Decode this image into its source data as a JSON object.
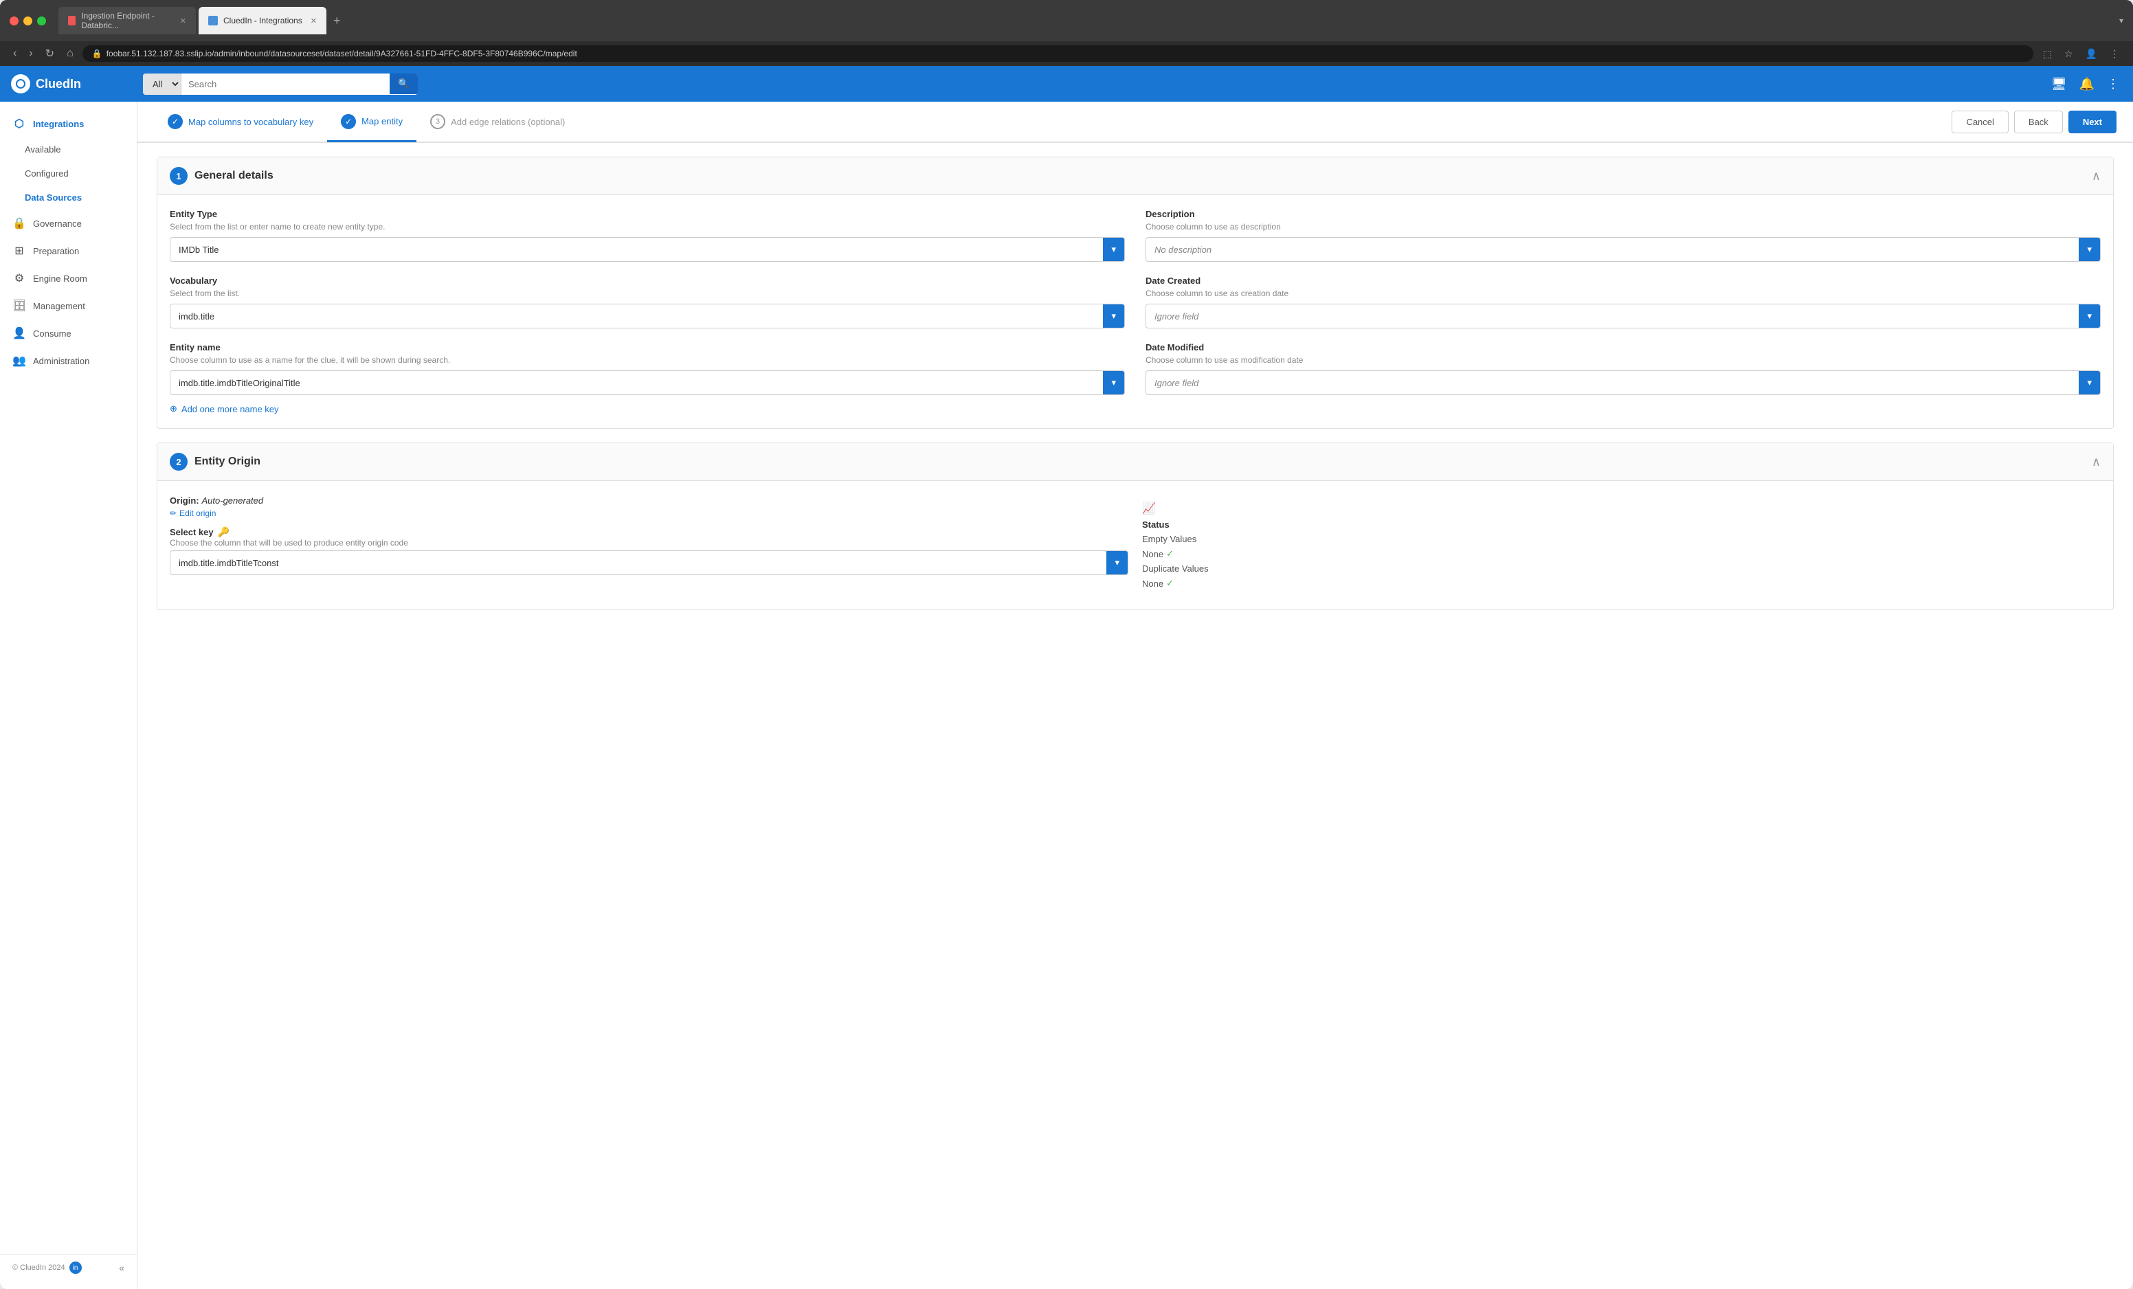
{
  "browser": {
    "url": "foobar.51.132.187.83.sslip.io/admin/inbound/datasourceset/dataset/detail/9A327661-51FD-4FFC-8DF5-3F80746B996C/map/edit",
    "tabs": [
      {
        "id": "tab1",
        "label": "Ingestion Endpoint - Databric...",
        "active": false,
        "favicon_color": "#e55"
      },
      {
        "id": "tab2",
        "label": "CluedIn - Integrations",
        "active": true,
        "favicon_color": "#4a90d9"
      }
    ]
  },
  "topnav": {
    "logo": "CluedIn",
    "search_dropdown": "All",
    "search_placeholder": "Search"
  },
  "sidebar": {
    "items": [
      {
        "id": "integrations",
        "label": "Integrations",
        "icon": "⬡",
        "active": true
      },
      {
        "id": "available",
        "label": "Available",
        "icon": "",
        "active": false,
        "indent": true
      },
      {
        "id": "configured",
        "label": "Configured",
        "icon": "",
        "active": false,
        "indent": true
      },
      {
        "id": "data-sources",
        "label": "Data Sources",
        "icon": "",
        "active": false,
        "indent": true,
        "highlighted": true
      },
      {
        "id": "governance",
        "label": "Governance",
        "icon": "🔒",
        "active": false
      },
      {
        "id": "preparation",
        "label": "Preparation",
        "icon": "⊞",
        "active": false
      },
      {
        "id": "engine-room",
        "label": "Engine Room",
        "icon": "⚙",
        "active": false
      },
      {
        "id": "management",
        "label": "Management",
        "icon": "🗄",
        "active": false
      },
      {
        "id": "consume",
        "label": "Consume",
        "icon": "👤",
        "active": false
      },
      {
        "id": "administration",
        "label": "Administration",
        "icon": "👥",
        "active": false
      }
    ],
    "footer": "© CluedIn 2024",
    "collapse_icon": "«"
  },
  "wizard": {
    "steps": [
      {
        "id": "step1",
        "label": "Map columns to vocabulary key",
        "status": "completed",
        "number": "1"
      },
      {
        "id": "step2",
        "label": "Map entity",
        "status": "active",
        "number": "2"
      },
      {
        "id": "step3",
        "label": "Add edge relations (optional)",
        "status": "pending",
        "number": "3"
      }
    ],
    "actions": {
      "cancel": "Cancel",
      "back": "Back",
      "next": "Next"
    }
  },
  "sections": {
    "general": {
      "number": "1",
      "title": "General details",
      "entity_type": {
        "label": "Entity Type",
        "hint": "Select from the list or enter name to create new entity type.",
        "value": "IMDb Title"
      },
      "description": {
        "label": "Description",
        "hint": "Choose column to use as description",
        "value": "No description"
      },
      "vocabulary": {
        "label": "Vocabulary",
        "hint": "Select from the list.",
        "value": "imdb.title"
      },
      "date_created": {
        "label": "Date Created",
        "hint": "Choose column to use as creation date",
        "value": "Ignore field"
      },
      "entity_name": {
        "label": "Entity name",
        "hint": "Choose column to use as a name for the clue, it will be shown during search.",
        "value": "imdb.title.imdbTitleOriginalTitle"
      },
      "date_modified": {
        "label": "Date Modified",
        "hint": "Choose column to use as modification date",
        "value": "Ignore field"
      },
      "add_name_key": "Add one more name key"
    },
    "entity_origin": {
      "number": "2",
      "title": "Entity Origin",
      "origin_label": "Origin:",
      "origin_value": "Auto-generated",
      "edit_label": "Edit origin",
      "select_key_label": "Select key",
      "select_key_hint": "Choose the column that will be used to produce entity origin code",
      "select_key_value": "imdb.title.imdbTitleTconst",
      "status": {
        "title": "Status",
        "empty_values_label": "Empty Values",
        "empty_values_value": "None",
        "duplicate_values_label": "Duplicate Values",
        "duplicate_values_value": "None"
      }
    }
  }
}
